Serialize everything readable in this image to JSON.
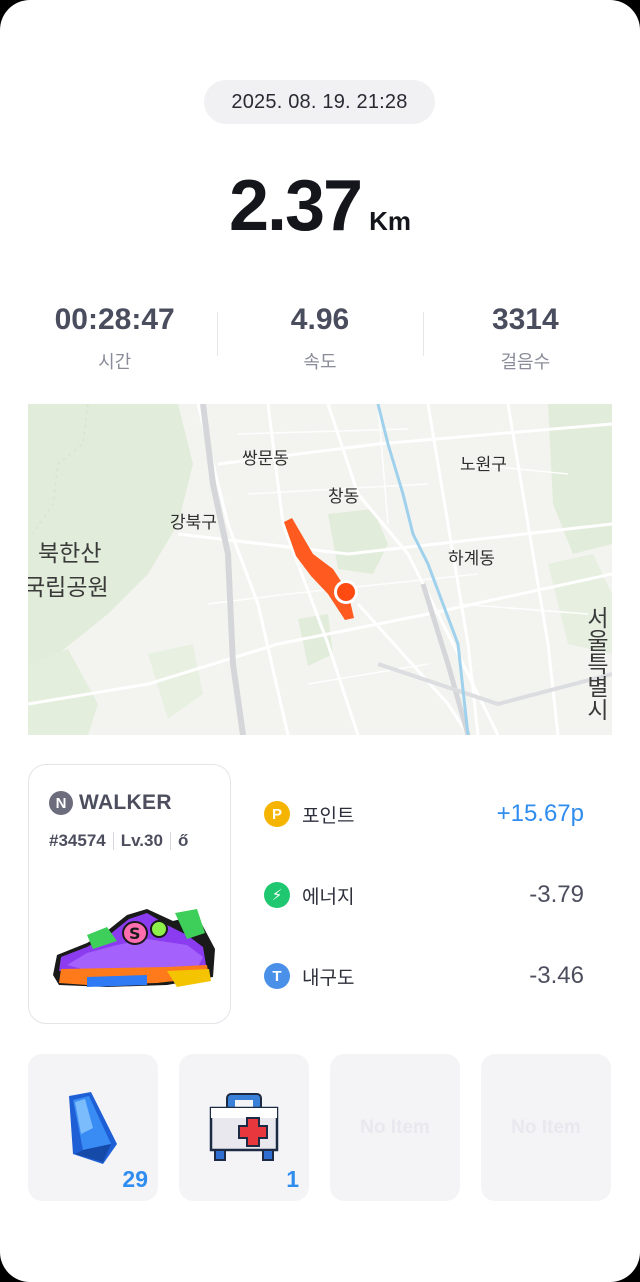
{
  "session": {
    "datetime": "2025. 08. 19. 21:28",
    "distance_value": "2.37",
    "distance_unit": "Km"
  },
  "stats": [
    {
      "value": "00:28:47",
      "label": "시간"
    },
    {
      "value": "4.96",
      "label": "속도"
    },
    {
      "value": "3314",
      "label": "걸음수"
    }
  ],
  "map": {
    "labels": {
      "ssangmun": "쌍문동",
      "nowon": "노원구",
      "chang": "창동",
      "gangbuk": "강북구",
      "bukhansan_1": "북한산",
      "bukhansan_2": "국립공원",
      "hagye": "하계동",
      "seoul": "서울특별시"
    },
    "route_color": "#ff5a1f",
    "marker_color": "#ff4a12"
  },
  "walker": {
    "badge_letter": "N",
    "title": "WALKER",
    "id": "#34574",
    "level": "Lv.30",
    "extra_glyph": "ő",
    "icon": "sneaker-icon"
  },
  "rewards": [
    {
      "icon": "point-icon",
      "icon_text": "P",
      "color": "#f5b400",
      "label": "포인트",
      "value": "+15.67p"
    },
    {
      "icon": "energy-icon",
      "icon_text": "⚡",
      "color": "#1fc770",
      "label": "에너지",
      "value": "-3.79"
    },
    {
      "icon": "durability-icon",
      "icon_text": "T",
      "color": "#4a8fe8",
      "label": "내구도",
      "value": "-3.46"
    }
  ],
  "items": [
    {
      "icon": "blue-crystal-icon",
      "count": "29"
    },
    {
      "icon": "first-aid-kit-icon",
      "count": "1"
    },
    {
      "empty_label": "No Item"
    },
    {
      "empty_label": "No Item"
    }
  ],
  "colors": {
    "accent_blue": "#2f8df0",
    "text_dark": "#15151c",
    "text_muted": "#8a8c99"
  }
}
